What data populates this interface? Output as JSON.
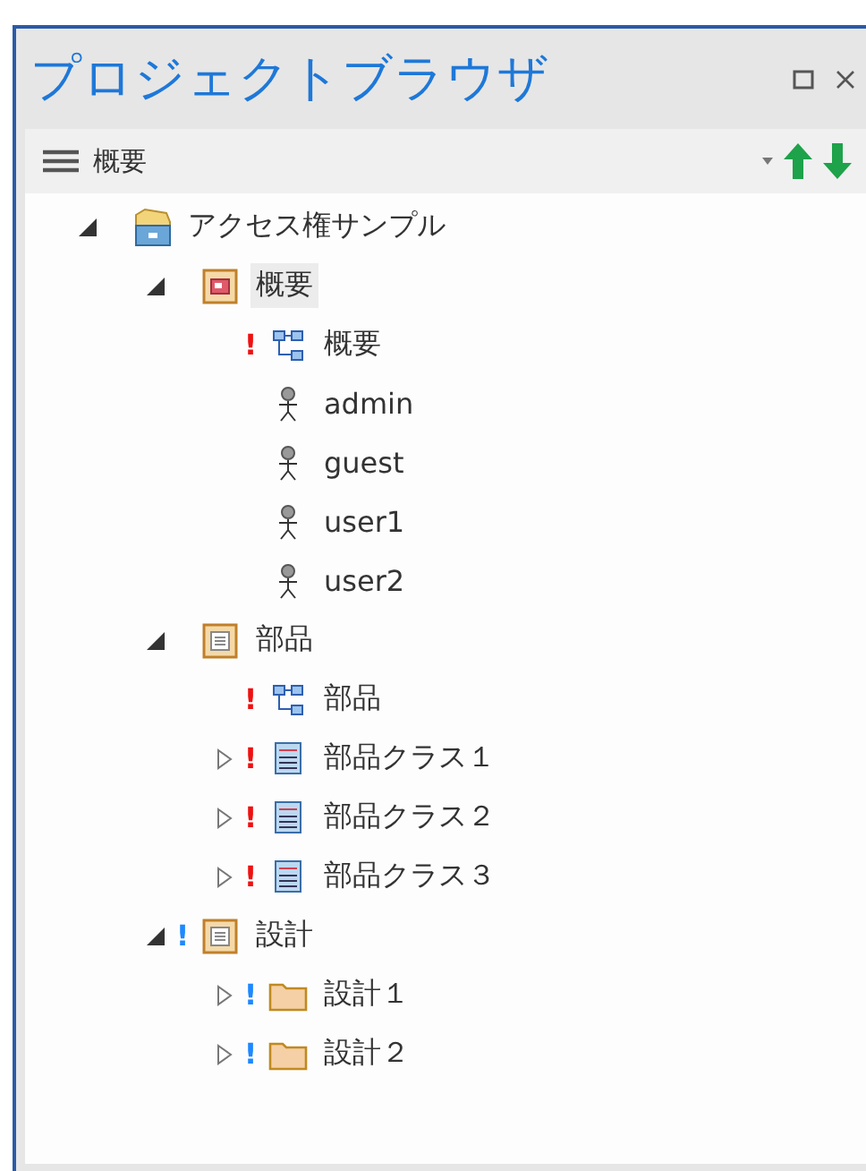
{
  "window": {
    "title": "プロジェクトブラウザ"
  },
  "toolbar": {
    "label": "概要"
  },
  "tree": [
    {
      "label": "アクセス権サンプル",
      "kind": "model",
      "expanded": true,
      "selected": false,
      "children": [
        {
          "label": "概要",
          "kind": "view",
          "expanded": true,
          "selected": true,
          "children": [
            {
              "label": "概要",
              "kind": "diagram",
              "flag": "!",
              "color": "#ee1111",
              "selected": false
            },
            {
              "label": "admin",
              "kind": "actor",
              "selected": false
            },
            {
              "label": "guest",
              "kind": "actor",
              "selected": false
            },
            {
              "label": "user1",
              "kind": "actor",
              "selected": false
            },
            {
              "label": "user2",
              "kind": "actor",
              "selected": false
            }
          ]
        },
        {
          "label": "部品",
          "kind": "view",
          "expanded": true,
          "selected": false,
          "children": [
            {
              "label": "部品",
              "kind": "diagram",
              "flag": "!",
              "color": "#ee1111",
              "selected": false
            },
            {
              "label": "部品クラス１",
              "kind": "class",
              "expanded": false,
              "flag": "!",
              "color": "#ee1111",
              "selected": false
            },
            {
              "label": "部品クラス２",
              "kind": "class",
              "expanded": false,
              "flag": "!",
              "color": "#ee1111",
              "selected": false
            },
            {
              "label": "部品クラス３",
              "kind": "class",
              "expanded": false,
              "flag": "!",
              "color": "#ee1111",
              "selected": false
            }
          ]
        },
        {
          "label": "設計",
          "kind": "view",
          "expanded": true,
          "flag": "!",
          "color": "#1e88ff",
          "selected": false,
          "children": [
            {
              "label": "設計１",
              "kind": "folder",
              "expanded": false,
              "flag": "!",
              "color": "#1e88ff",
              "selected": false
            },
            {
              "label": "設計２",
              "kind": "folder",
              "expanded": false,
              "flag": "!",
              "color": "#1e88ff",
              "selected": false
            }
          ]
        }
      ]
    }
  ]
}
